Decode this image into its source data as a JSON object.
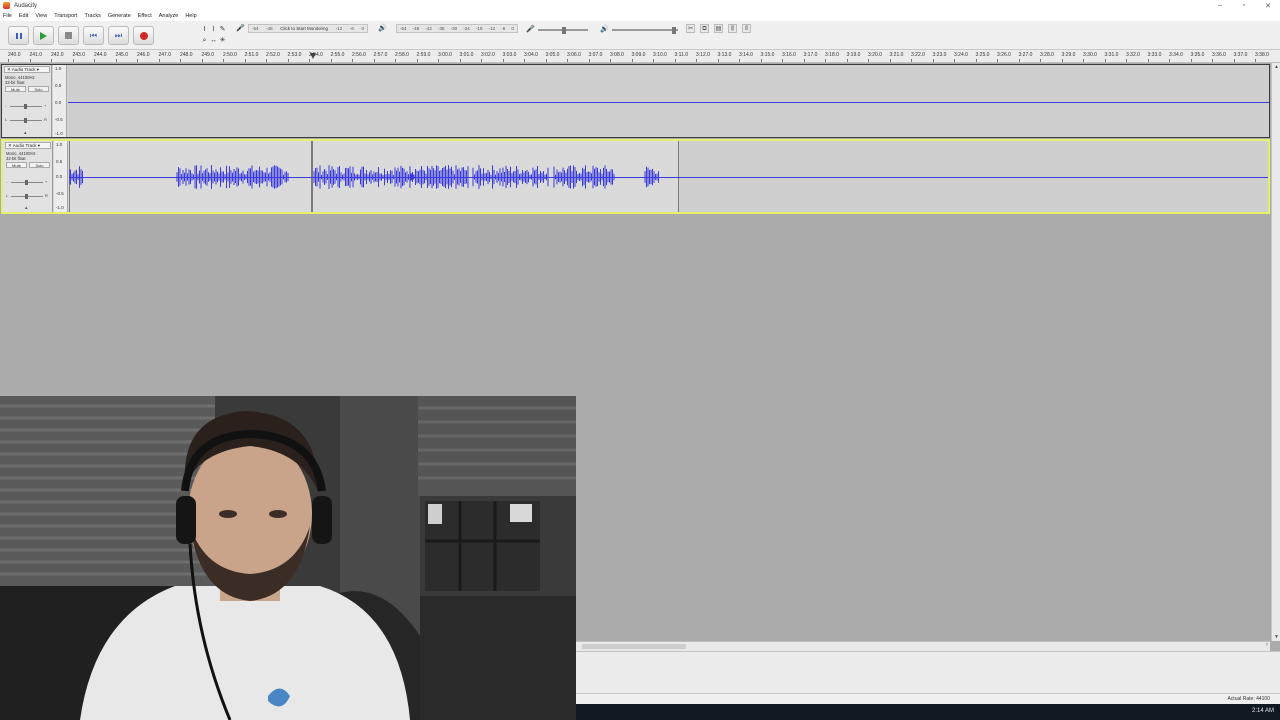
{
  "window": {
    "title": "Audacity",
    "minimize_icon": "minimize-icon",
    "maximize_icon": "maximize-icon",
    "close_icon": "close-icon"
  },
  "menu": [
    "File",
    "Edit",
    "View",
    "Transport",
    "Tracks",
    "Generate",
    "Effect",
    "Analyze",
    "Help"
  ],
  "transport_buttons": [
    "pause",
    "play",
    "stop",
    "skip-to-start",
    "skip-to-end",
    "record"
  ],
  "meters": {
    "record": {
      "ticks": [
        "-54",
        "-48"
      ],
      "hint": "Click to Start Monitoring",
      "ticks2": [
        "-12",
        "-6",
        "0"
      ]
    },
    "playback": {
      "ticks": [
        "-54",
        "-48",
        "-42",
        "-36",
        "-30",
        "-24",
        "-18",
        "-12",
        "-6",
        "0"
      ]
    }
  },
  "ruler": {
    "labels": [
      "240.0",
      "241.0",
      "242.0",
      "243.0",
      "244.0",
      "245.0",
      "246.0",
      "247.0",
      "248.0",
      "249.0",
      "2:50.0",
      "2:51.0",
      "2:52.0",
      "2:53.0",
      "2:54.0",
      "2:55.0",
      "2:56.0",
      "2:57.0",
      "2:58.0",
      "2:59.0",
      "3:00.0",
      "3:01.0",
      "3:02.0",
      "3:03.0",
      "3:04.0",
      "3:05.0",
      "3:06.0",
      "3:07.0",
      "3:08.0",
      "3:09.0",
      "3:10.0",
      "3:11.0",
      "3:12.0",
      "3:13.0",
      "3:14.0",
      "3:15.0",
      "3:16.0",
      "3:17.0",
      "3:18.0",
      "3:19.0",
      "3:20.0",
      "3:21.0",
      "3:22.0",
      "3:23.0",
      "3:24.0",
      "3:25.0",
      "3:26.0",
      "3:27.0",
      "3:28.0",
      "3:29.0",
      "3:30.0",
      "3:31.0",
      "3:32.0",
      "3:33.0",
      "3:34.0",
      "3:35.0",
      "3:36.0",
      "3:37.0",
      "3:38.0"
    ]
  },
  "tracks": [
    {
      "name": "Audio Track",
      "info1": "Mono, 44100Hz",
      "info2": "32-bit float",
      "mute": "Mute",
      "solo": "Solo",
      "scale": [
        "1.0",
        "0.5",
        "0.0",
        "-0.5",
        "-1.0"
      ],
      "selected": false,
      "has_audio": false
    },
    {
      "name": "Audio Track",
      "info1": "Mono, 44100Hz",
      "info2": "32-bit float",
      "mute": "Mute",
      "solo": "Solo",
      "scale": [
        "1.0",
        "0.5",
        "0.0",
        "-0.5",
        "-1.0"
      ],
      "selected": true,
      "has_audio": true
    }
  ],
  "status": {
    "actual_rate": "Actual Rate: 44100"
  },
  "taskbar": {
    "clock": "2:14 AM"
  },
  "webcam": {
    "description_icon": "webcam-feed"
  },
  "colors": {
    "waveform": "#3a3ae0",
    "selection_border": "#e6f06a",
    "record": "#d02a2a",
    "play": "#2e9a3a"
  }
}
